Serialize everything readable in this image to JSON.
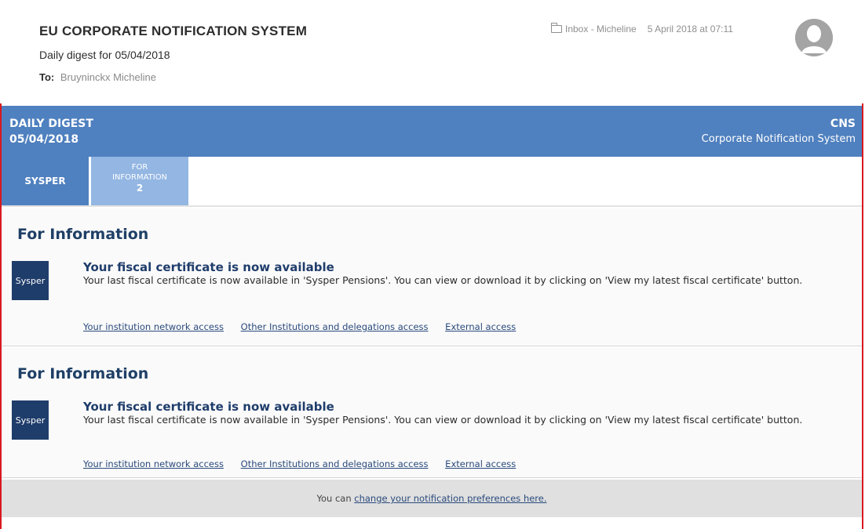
{
  "email": {
    "sender": "EU CORPORATE NOTIFICATION SYSTEM",
    "subject": "Daily digest for 05/04/2018",
    "to_label": "To:",
    "to_name": "Bruyninckx Micheline",
    "folder_icon": "folder-icon",
    "mailbox": "Inbox - Micheline",
    "date": "5 April 2018 at 07:11",
    "avatar_icon": "user-avatar-icon"
  },
  "banner": {
    "title_line1": "DAILY DIGEST",
    "title_line2": "05/04/2018",
    "right_line1": "CNS",
    "right_line2": "Corporate Notification System",
    "color": "#4f80bf"
  },
  "tabs": {
    "sysper": "SYSPER",
    "info_line1": "FOR",
    "info_line2": "INFORMATION",
    "info_count": "2"
  },
  "sections": [
    {
      "heading": "For Information",
      "badge": "Sysper",
      "title": "Your fiscal certificate is now available",
      "description": "Your last fiscal certificate is now available in 'Sysper Pensions'. You can view or download it by clicking on 'View my latest fiscal certificate' button.",
      "links": [
        "Your institution network access",
        "Other Institutions and delegations access",
        "External access"
      ]
    },
    {
      "heading": "For Information",
      "badge": "Sysper",
      "title": "Your fiscal certificate is now available",
      "description": "Your last fiscal certificate is now available in 'Sysper Pensions'. You can view or download it by clicking on 'View my latest fiscal certificate' button.",
      "links": [
        "Your institution network access",
        "Other Institutions and delegations access",
        "External access"
      ]
    }
  ],
  "footer": {
    "prefix": "You can",
    "link": "change your notification preferences here."
  }
}
